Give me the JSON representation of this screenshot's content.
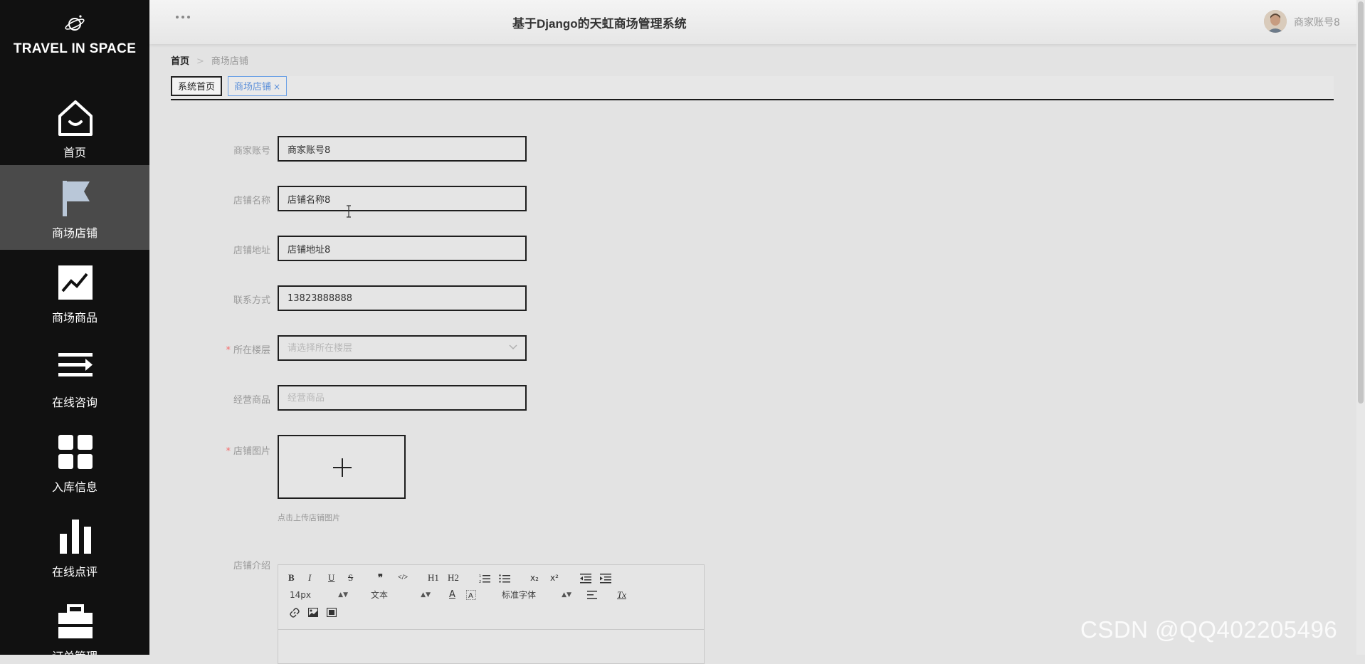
{
  "brand": {
    "name": "TRAVEL IN SPACE",
    "logo_icon": "planet-icon"
  },
  "sidebar": {
    "items": [
      {
        "label": "首页",
        "icon": "home-icon",
        "active": false
      },
      {
        "label": "商场店铺",
        "icon": "flag-icon",
        "active": true
      },
      {
        "label": "商场商品",
        "icon": "chart-line-icon",
        "active": false
      },
      {
        "label": "在线咨询",
        "icon": "list-icon",
        "active": false
      },
      {
        "label": "入库信息",
        "icon": "grid-icon",
        "active": false
      },
      {
        "label": "在线点评",
        "icon": "bar-chart-icon",
        "active": false
      },
      {
        "label": "订单管理",
        "icon": "briefcase-icon",
        "active": false
      }
    ]
  },
  "header": {
    "title": "基于Django的天虹商场管理系统",
    "user_name": "商家账号8"
  },
  "breadcrumb": {
    "home": "首页",
    "separator": ">",
    "current": "商场店铺"
  },
  "tabs": [
    {
      "label": "系统首页",
      "active": false
    },
    {
      "label": "商场店铺",
      "active": true,
      "close": "×"
    }
  ],
  "form": {
    "merchant_account": {
      "label": "商家账号",
      "value": "商家账号8"
    },
    "shop_name": {
      "label": "店铺名称",
      "value": "店铺名称8"
    },
    "shop_address": {
      "label": "店铺地址",
      "value": "店铺地址8"
    },
    "contact": {
      "label": "联系方式",
      "value": "13823888888"
    },
    "floor": {
      "label": "所在楼层",
      "required": "*",
      "placeholder": "请选择所在楼层"
    },
    "products": {
      "label": "经营商品",
      "placeholder": "经营商品"
    },
    "shop_image": {
      "label": "店铺图片",
      "required": "*",
      "hint": "点击上传店铺图片"
    },
    "shop_intro": {
      "label": "店铺介绍"
    }
  },
  "editor": {
    "font_size": "14px",
    "header_type": "文本",
    "font_family": "标准字体",
    "buttons": {
      "bold": "B",
      "italic": "I",
      "underline": "U",
      "strike": "S",
      "quote": "❞",
      "code": "</>",
      "h1": "H1",
      "h2": "H2",
      "sub": "x₂",
      "sup": "x²",
      "color": "A",
      "clean": "Tx"
    }
  },
  "watermark": "CSDN @QQ402205496",
  "colors": {
    "sidebar_bg": "#111111",
    "active_item_bg": "#4a4a4a",
    "accent": "#5b8fd9",
    "required": "#f56c6c"
  }
}
